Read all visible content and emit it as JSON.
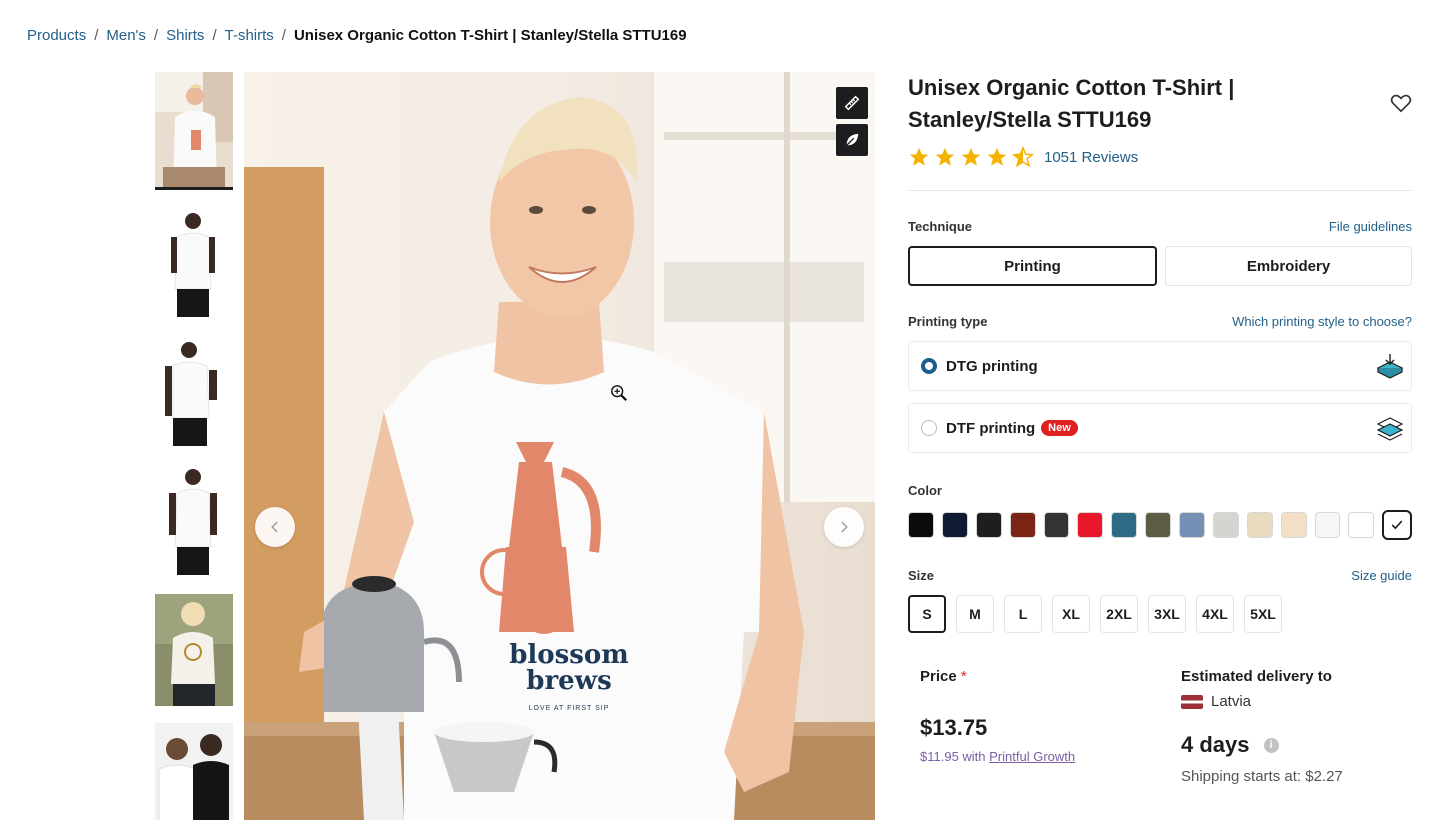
{
  "breadcrumb": {
    "items": [
      "Products",
      "Men's",
      "Shirts",
      "T-shirts"
    ],
    "current": "Unisex Organic Cotton T-Shirt | Stanley/Stella STTU169"
  },
  "product": {
    "title": "Unisex Organic Cotton T-Shirt | Stanley/Stella STTU169",
    "rating": 4.5,
    "reviews": "1051 Reviews",
    "shirt_print": {
      "line1": "blossom",
      "line2": "brews",
      "tagline": "LOVE AT FIRST SIP"
    }
  },
  "technique": {
    "label": "Technique",
    "link": "File guidelines",
    "options": [
      "Printing",
      "Embroidery"
    ],
    "selected": "Printing"
  },
  "printing_type": {
    "label": "Printing type",
    "link": "Which printing style to choose?",
    "options": [
      {
        "name": "DTG printing",
        "badge": "",
        "selected": true
      },
      {
        "name": "DTF printing",
        "badge": "New",
        "selected": false
      }
    ]
  },
  "color": {
    "label": "Color",
    "swatches": [
      "#0b0b0b",
      "#0f1b33",
      "#1e1e1e",
      "#7a2418",
      "#333333",
      "#e8172b",
      "#2f6b85",
      "#5d5b44",
      "#7590b5",
      "#d6d4d0",
      "#e9dcc0",
      "#f3dfc5",
      "#f6f6f6",
      "#ffffff",
      "#ffffff"
    ],
    "selected_index": 14
  },
  "size": {
    "label": "Size",
    "link": "Size guide",
    "options": [
      "S",
      "M",
      "L",
      "XL",
      "2XL",
      "3XL",
      "4XL",
      "5XL"
    ],
    "selected": "S"
  },
  "price": {
    "label": "Price",
    "required_mark": "*",
    "value": "$13.75",
    "growth_price": "$11.95 with ",
    "growth_link": "Printful Growth"
  },
  "delivery": {
    "label": "Estimated delivery to",
    "country": "Latvia",
    "days": "4 days",
    "info": "i",
    "shipping": "Shipping starts at: $2.27"
  },
  "colors": {
    "link": "#226089",
    "accent": "#1a5e8c",
    "star": "#f5b301",
    "new_badge": "#e02020",
    "growth": "#7b5ea7"
  }
}
